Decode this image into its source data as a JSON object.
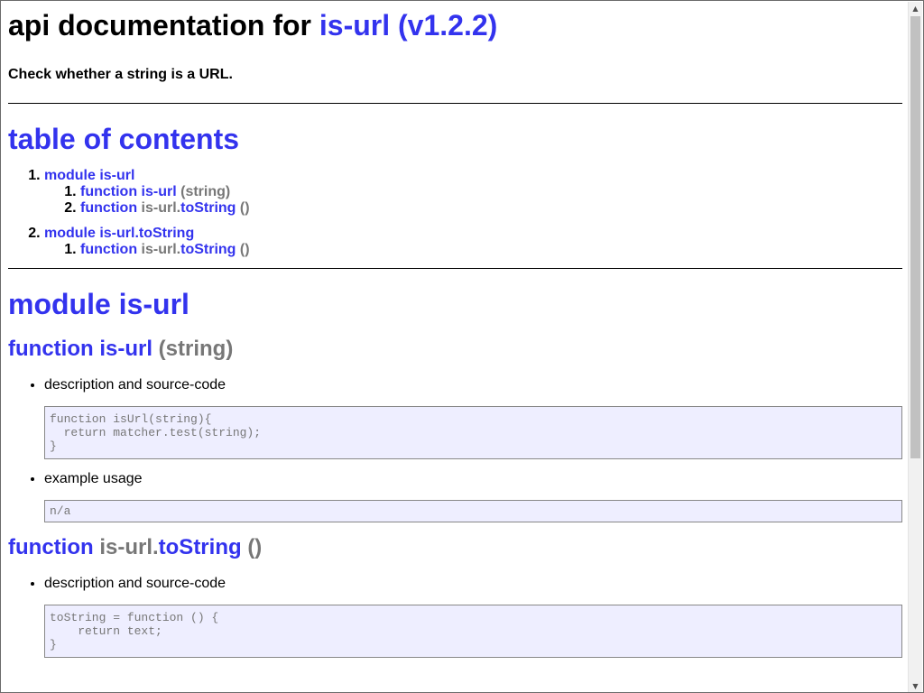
{
  "header": {
    "title_prefix": "api documentation for",
    "package_link": "is-url (v1.2.2)",
    "description": "Check whether a string is a URL."
  },
  "toc": {
    "title": "table of contents",
    "modules": [
      {
        "label": "module is-url",
        "items": [
          {
            "keyword": "function",
            "prefix": "",
            "name": "is-url",
            "args": "(string)"
          },
          {
            "keyword": "function",
            "prefix": "is-url.",
            "name": "toString",
            "args": "()"
          }
        ]
      },
      {
        "label": "module is-url.toString",
        "items": [
          {
            "keyword": "function",
            "prefix": "is-url.",
            "name": "toString",
            "args": "()"
          }
        ]
      }
    ]
  },
  "module": {
    "title": "module is-url",
    "functions": [
      {
        "keyword": "function",
        "prefix": "",
        "name": "is-url",
        "args": "(string)",
        "desc_label": "description and source-code",
        "code": "function isUrl(string){\n  return matcher.test(string);\n}",
        "example_label": "example usage",
        "example": "n/a"
      },
      {
        "keyword": "function",
        "prefix": "is-url.",
        "name": "toString",
        "args": "()",
        "desc_label": "description and source-code",
        "code": "toString = function () {\n    return text;\n}"
      }
    ]
  },
  "scrollbar": {
    "up_arrow": "▲",
    "down_arrow": "▼"
  }
}
